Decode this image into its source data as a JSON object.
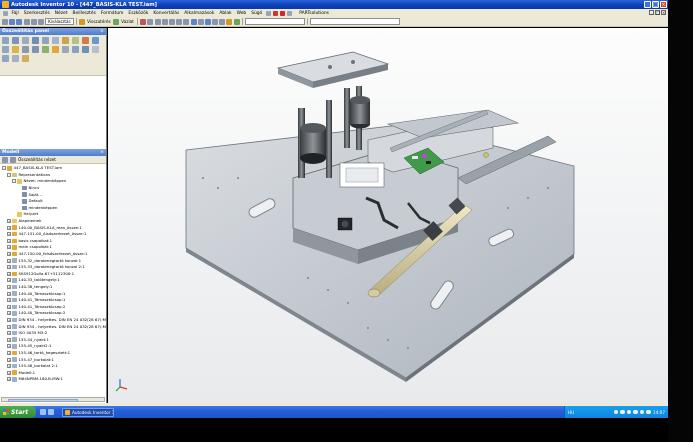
{
  "window": {
    "title": "Autodesk Inventor 10 - [447_BASIS-KLA TEST.iam]",
    "buttons": [
      "_",
      "□",
      "×"
    ]
  },
  "menu": {
    "items": [
      "Fájl",
      "Szerkesztés",
      "Nézet",
      "Beillesztés",
      "Formátum",
      "Eszközök",
      "Konvertálás",
      "Alkalmazások",
      "Ablak",
      "Web",
      "Súgó"
    ],
    "partsolutions": "PARTsolutions"
  },
  "toolbar": {
    "return_label": "Visszatérés",
    "select_value": "Kiválasztás",
    "sketch_label": "Vázlat"
  },
  "panel": {
    "title": "Összeállítás panel",
    "close": "×"
  },
  "model": {
    "title": "Modell",
    "filter_label": "Összeállítás nézet",
    "tree": [
      {
        "label": "447_BASIS-KLA TEST.iam",
        "level": 0,
        "icon": "asm",
        "exp": "-"
      },
      {
        "label": "Representations",
        "level": 1,
        "icon": "rep",
        "exp": "-"
      },
      {
        "label": "Nézet: mindenképpen",
        "level": 2,
        "icon": "fld",
        "exp": "-"
      },
      {
        "label": "Nincs",
        "level": 3,
        "icon": "cam",
        "exp": ""
      },
      {
        "label": "Saját...",
        "level": 3,
        "icon": "cam",
        "exp": ""
      },
      {
        "label": "Default",
        "level": 3,
        "icon": "cam",
        "exp": ""
      },
      {
        "label": "mindenképpen",
        "level": 3,
        "icon": "cam",
        "exp": ""
      },
      {
        "label": "Helyzet",
        "level": 2,
        "icon": "fld",
        "exp": ""
      },
      {
        "label": "Alapelemek",
        "level": 1,
        "icon": "fld",
        "exp": "+"
      },
      {
        "label": "140-00_BASIS-KLA_man_össze:1",
        "level": 1,
        "icon": "asm",
        "exp": "+"
      },
      {
        "label": "447-151-00_Alsószerkezet_össze:1",
        "level": 1,
        "icon": "asm",
        "exp": "+"
      },
      {
        "label": "basis csapolkat:1",
        "level": 1,
        "icon": "asm",
        "exp": "+"
      },
      {
        "label": "main csapolkat:1",
        "level": 1,
        "icon": "asm",
        "exp": "+"
      },
      {
        "label": "447-150-00_felsőszerkezet_össze:1",
        "level": 1,
        "icon": "asm",
        "exp": "+"
      },
      {
        "label": "155-32_darabmegtartó konzol:1",
        "level": 1,
        "icon": "prt",
        "exp": "+"
      },
      {
        "label": "155-33_darabmegtartó konzol 2:1",
        "level": 1,
        "icon": "prt",
        "exp": "+"
      },
      {
        "label": "SKS912Golla-67+5112300:1",
        "level": 1,
        "icon": "asm",
        "exp": "+"
      },
      {
        "label": "140-33_tolótengely:1",
        "level": 1,
        "icon": "prt",
        "exp": "+"
      },
      {
        "label": "140-38_tengely:1",
        "level": 1,
        "icon": "prt",
        "exp": "+"
      },
      {
        "label": "140-40_Támasztócsap:1",
        "level": 1,
        "icon": "prt",
        "exp": "+"
      },
      {
        "label": "140-41_Támasztócsap:1",
        "level": 1,
        "icon": "prt",
        "exp": "+"
      },
      {
        "label": "140-41_Támasztócsap:2",
        "level": 1,
        "icon": "prt",
        "exp": "+"
      },
      {
        "label": "140-40_Támasztócsap:2",
        "level": 1,
        "icon": "prt",
        "exp": "+"
      },
      {
        "label": "DIN 934 - helyettes. DIN EN 24 032(28 67):M",
        "level": 1,
        "icon": "prt",
        "exp": "+"
      },
      {
        "label": "DIN 934 - helyettes. DIN EN 24 032(28 67):M",
        "level": 1,
        "icon": "prt",
        "exp": "+"
      },
      {
        "label": "ISO 4035 M3:2",
        "level": 1,
        "icon": "prt",
        "exp": "+"
      },
      {
        "label": "155-44_nyakt:1",
        "level": 1,
        "icon": "prt",
        "exp": "+"
      },
      {
        "label": "155-45_nyakt2:1",
        "level": 1,
        "icon": "prt",
        "exp": "+"
      },
      {
        "label": "155-46_tartó_hegesztett:1",
        "level": 1,
        "icon": "asm",
        "exp": "+"
      },
      {
        "label": "155-47_burkolat:1",
        "level": 1,
        "icon": "prt",
        "exp": "+"
      },
      {
        "label": "155-48_burkolat 2:1",
        "level": 1,
        "icon": "prt",
        "exp": "+"
      },
      {
        "label": "Modell:1",
        "level": 1,
        "icon": "asm",
        "exp": "+"
      },
      {
        "label": "M64NPBM-180-B-MW:1",
        "level": 1,
        "icon": "prt",
        "exp": "+"
      }
    ]
  },
  "taskbar": {
    "start": "Start",
    "task_item": "Autodesk Inventor 1...",
    "lang": "HU",
    "clock": "14:07"
  }
}
